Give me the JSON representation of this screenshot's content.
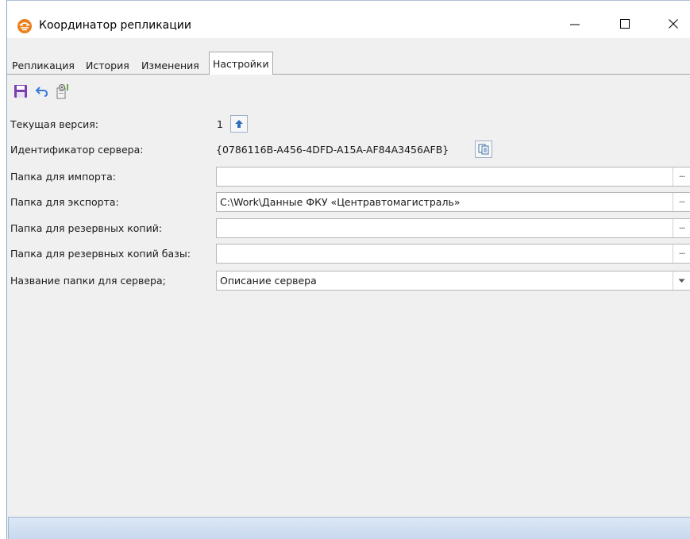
{
  "window": {
    "title": "Координатор репликации",
    "app_icon": "replication-app-icon",
    "controls": {
      "minimize": "minimize-icon",
      "maximize": "maximize-icon",
      "close": "close-icon"
    }
  },
  "tabs": [
    {
      "label": "Репликация",
      "active": false
    },
    {
      "label": "История",
      "active": false
    },
    {
      "label": "Изменения",
      "active": false
    },
    {
      "label": "Настройки",
      "active": true
    }
  ],
  "toolbar": {
    "save_icon": "save-icon",
    "undo_icon": "undo-icon",
    "settings_icon": "settings-icon"
  },
  "form": {
    "current_version": {
      "label": "Текущая версия:",
      "value": "1"
    },
    "server_id": {
      "label": "Идентификатор сервера:",
      "value": "{0786116B-A456-4DFD-A15A-AF84A3456AFB}"
    },
    "import_folder": {
      "label": "Папка для импорта:",
      "value": ""
    },
    "export_folder": {
      "label": "Папка для экспорта:",
      "value": "C:\\Work\\Данные ФКУ «Центравтомагистраль»"
    },
    "backup_folder": {
      "label": "Папка для резервных копий:",
      "value": ""
    },
    "db_backup_folder": {
      "label": "Папка для резервных копий базы:",
      "value": ""
    },
    "server_folder_name": {
      "label": "Название папки для сервера;",
      "value": "Описание сервера"
    },
    "ellipsis": "···"
  },
  "colors": {
    "accent_orange": "#e8811c",
    "upgrade_arrow": "#2f6fc0",
    "save_purple": "#7a3fb0",
    "undo_blue": "#3a7bd5",
    "statusbar": "#c7d9ee"
  }
}
